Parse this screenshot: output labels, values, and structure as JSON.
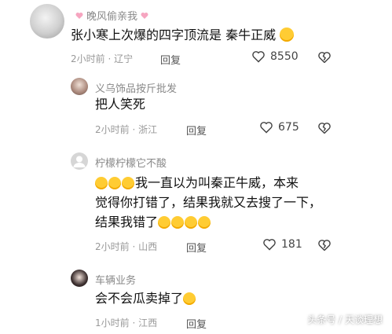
{
  "comments": [
    {
      "name": "晚风偷亲我",
      "text": "张小寒上次爆的四字顶流是 秦牛正威",
      "time": "2小时前",
      "location": "辽宁",
      "reply": "回复",
      "likes": "8550"
    },
    {
      "name": "义乌饰品按斤批发",
      "text": "把人笑死",
      "time": "2小时前",
      "location": "浙江",
      "reply": "回复",
      "likes": "675"
    },
    {
      "name": "柠檬柠檬它不酸",
      "lines": [
        "我一直以为叫秦正牛威，本来",
        "觉得你打错了，结果我就又去搜了一下，",
        "结果我错了"
      ],
      "time": "2小时前",
      "location": "山西",
      "reply": "回复",
      "likes": "181"
    },
    {
      "name": "车辆业务",
      "text": "会不会瓜卖掉了",
      "time": "1小时前",
      "location": "江西",
      "reply": "回复"
    }
  ],
  "separator": "·",
  "watermark": "头条号 / 天谈理想",
  "colors": {
    "heart_pink": "#f6a5c0",
    "emoji": "#ffcc33"
  }
}
